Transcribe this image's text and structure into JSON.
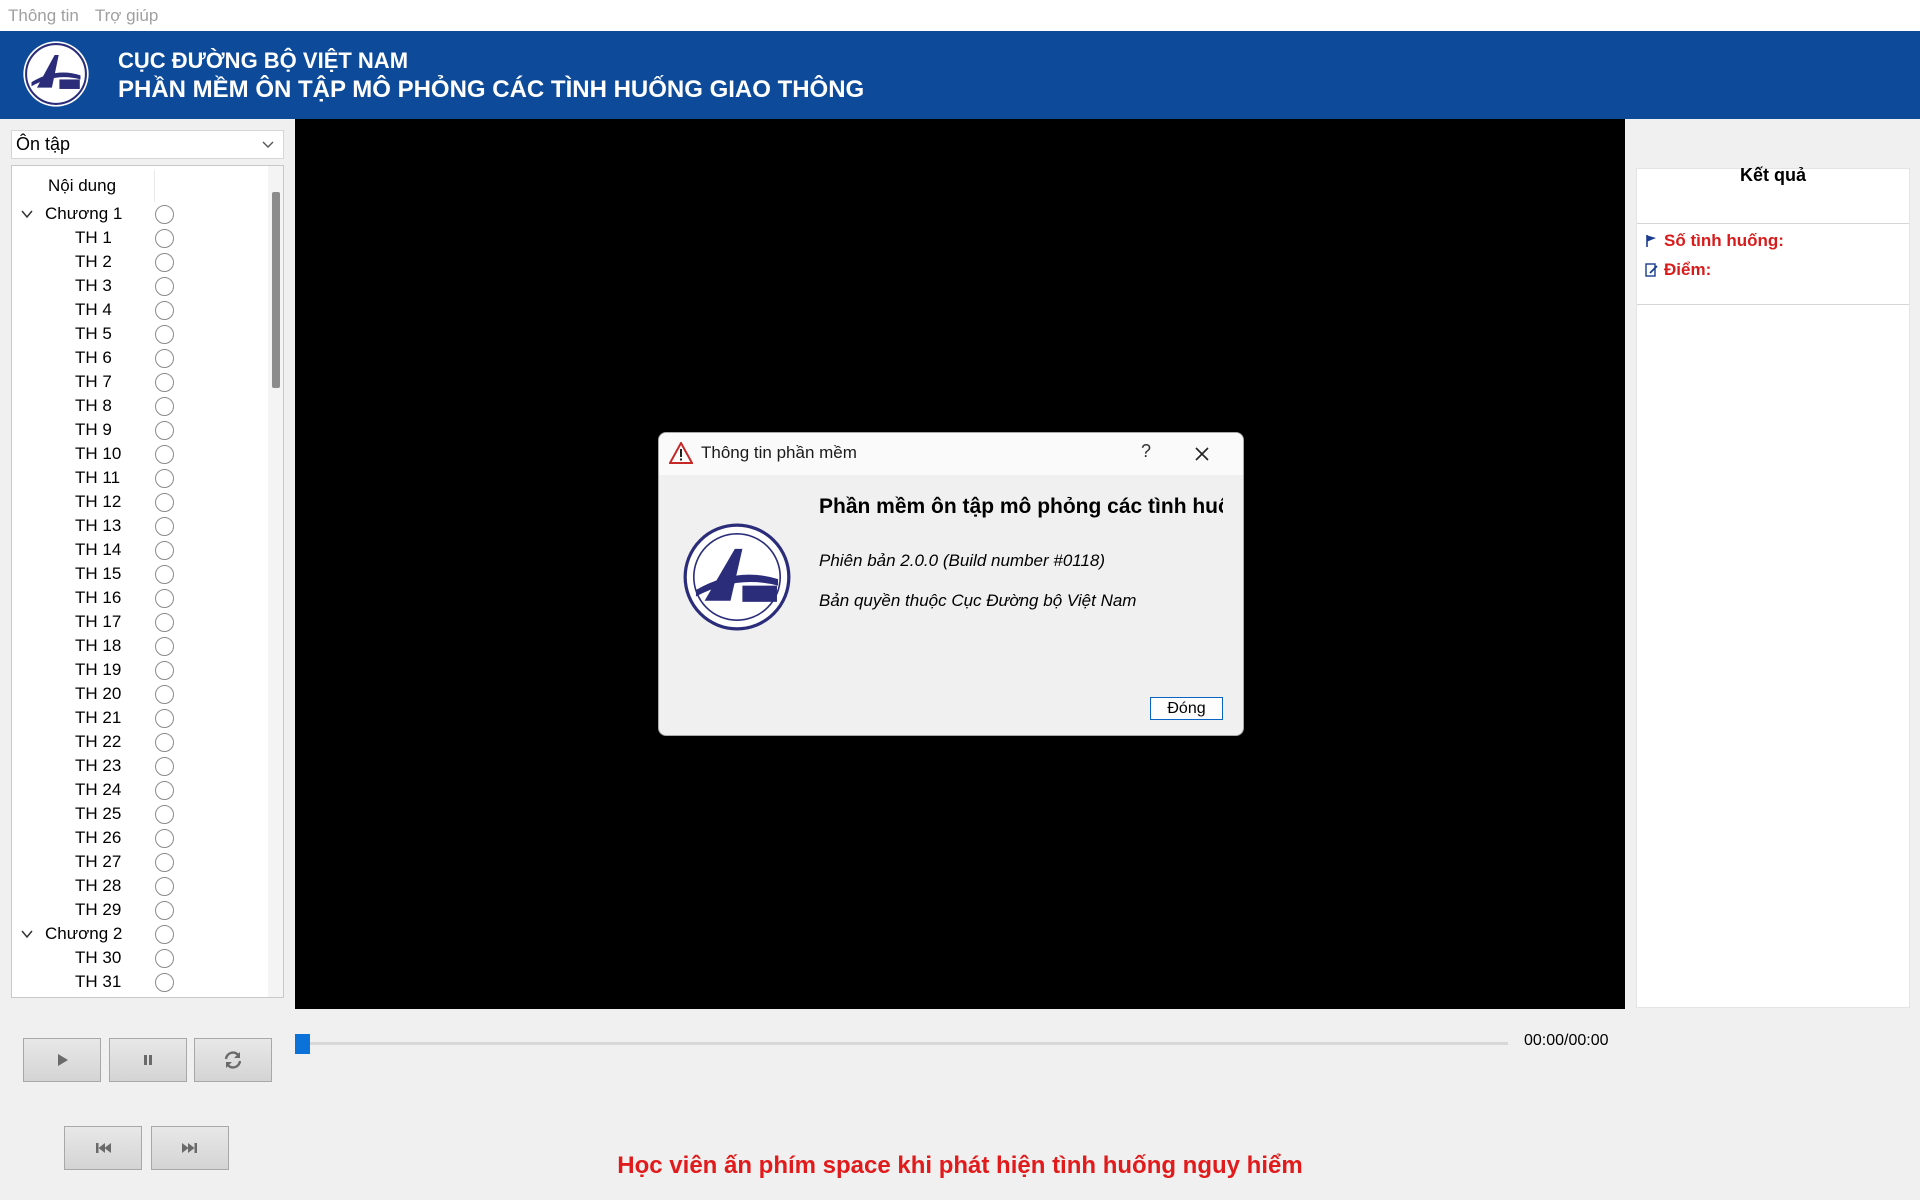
{
  "menu": {
    "items": [
      "Thông tin",
      "Trợ giúp"
    ]
  },
  "header": {
    "line1": "CỤC ĐƯỜNG BỘ VIỆT NAM",
    "line2": "PHẦN MỀM ÔN TẬP MÔ PHỎNG CÁC TÌNH HUỐNG GIAO THÔNG",
    "logo_icon": "drvn-logo-icon"
  },
  "mode_select": {
    "value": "Ôn tập"
  },
  "tree": {
    "column_title": "Nội dung",
    "chapter1": "Chương 1",
    "chapter2": "Chương 2",
    "items_ch1": [
      "TH 1",
      "TH 2",
      "TH 3",
      "TH 4",
      "TH 5",
      "TH 6",
      "TH 7",
      "TH 8",
      "TH 9",
      "TH 10",
      "TH 11",
      "TH 12",
      "TH 13",
      "TH 14",
      "TH 15",
      "TH 16",
      "TH 17",
      "TH 18",
      "TH 19",
      "TH 20",
      "TH 21",
      "TH 22",
      "TH 23",
      "TH 24",
      "TH 25",
      "TH 26",
      "TH 27",
      "TH 28",
      "TH 29"
    ],
    "items_ch2": [
      "TH 30",
      "TH 31"
    ]
  },
  "results": {
    "title": "Kết quả",
    "count_label": "Số tình huống:",
    "score_label": "Điểm:"
  },
  "player": {
    "time": "00:00/00:00",
    "progress": 0
  },
  "hint": "Học viên ấn phím space khi phát hiện tình huống nguy hiểm",
  "dialog": {
    "title": "Thông tin phần mềm",
    "help": "?",
    "heading": "Phần mềm ôn tập mô phỏng các tình huống giao thông",
    "version": "Phiên bản 2.0.0 (Build number #0118)",
    "copyright": "Bản quyền thuộc Cục Đường bộ Việt Nam",
    "close_label": "Đóng"
  },
  "colors": {
    "header_bg": "#0d4a9a",
    "hint_red": "#e11b1b",
    "result_red": "#d81b1b",
    "progress_blue": "#0a72d8"
  }
}
